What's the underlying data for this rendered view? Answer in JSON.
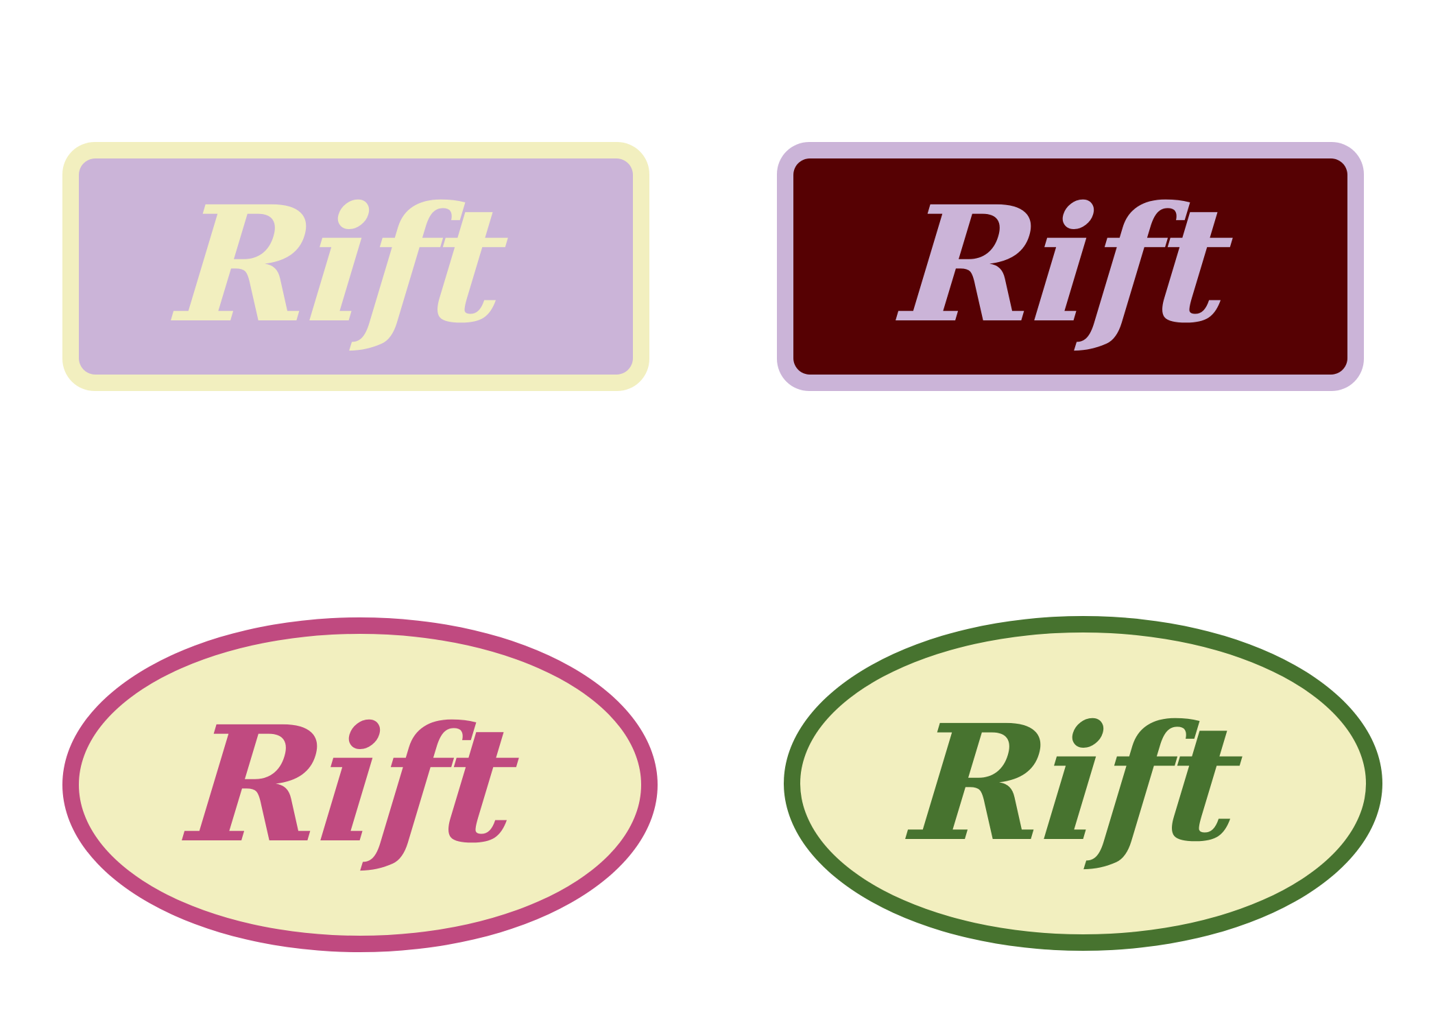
{
  "logo_variants": [
    {
      "id": "rect-cream-lavender",
      "shape": "rounded-rectangle",
      "text": "Rift",
      "colors": {
        "border": "#f2efbf",
        "fill": "#cbb4d8",
        "text": "#f2efbf"
      }
    },
    {
      "id": "rect-lavender-maroon",
      "shape": "rounded-rectangle",
      "text": "Rift",
      "colors": {
        "border": "#cbb4d8",
        "fill": "#560103",
        "text": "#cbb4d8"
      }
    },
    {
      "id": "oval-magenta-cream",
      "shape": "oval",
      "text": "Rift",
      "colors": {
        "border": "#c04a80",
        "fill": "#f2efbf",
        "text": "#c04a80"
      }
    },
    {
      "id": "oval-green-cream",
      "shape": "oval",
      "text": "Rift",
      "colors": {
        "border": "#47732f",
        "fill": "#f2efbf",
        "text": "#47732f"
      }
    }
  ]
}
